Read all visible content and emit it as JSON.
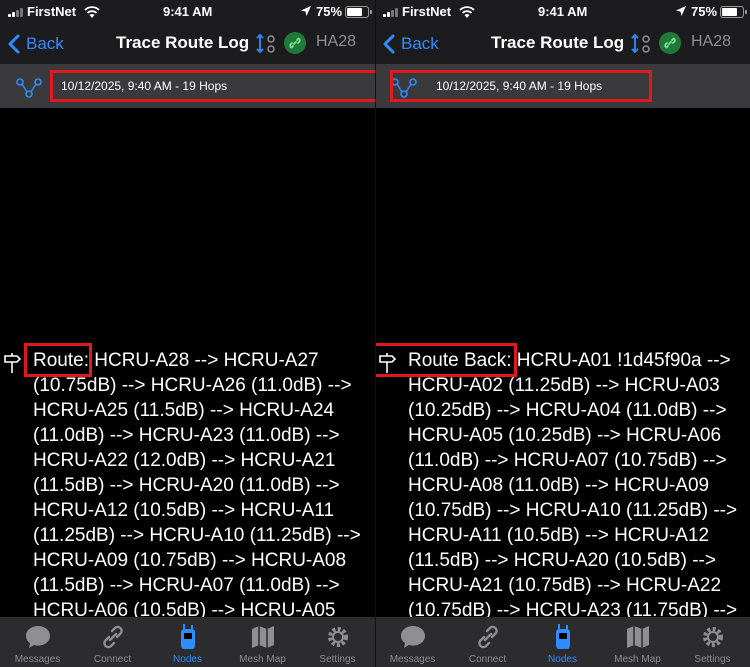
{
  "status_bar": {
    "carrier": "FirstNet",
    "time": "9:41 AM",
    "battery": "75%",
    "battery_level": 0.75
  },
  "nav": {
    "back_label": "Back",
    "title": "Trace Route Log",
    "node_short_name": "HA28"
  },
  "log_entry": {
    "label": "10/12/2025, 9:40 AM - 19 Hops"
  },
  "route_forward": {
    "label": "Route:",
    "text": " HCRU-A28 --> HCRU-A27 (10.75dB) --> HCRU-A26 (11.0dB) --> HCRU-A25 (11.5dB) --> HCRU-A24 (11.0dB) --> HCRU-A23 (11.0dB) --> HCRU-A22 (12.0dB) --> HCRU-A21 (11.5dB) --> HCRU-A20 (11.0dB) --> HCRU-A12 (10.5dB) --> HCRU-A11 (11.25dB) --> HCRU-A10 (11.25dB) --> HCRU-A09 (10.75dB) --> HCRU-A08 (11.5dB) --> HCRU-A07 (11.0dB) --> HCRU-A06 (10.5dB) --> HCRU-A05"
  },
  "route_back": {
    "label": "Route Back:",
    "text": " HCRU-A01 !1d45f90a --> HCRU-A02 (11.25dB) --> HCRU-A03 (10.25dB) --> HCRU-A04 (11.0dB) --> HCRU-A05 (10.25dB) --> HCRU-A06 (11.0dB) --> HCRU-A07 (10.75dB) --> HCRU-A08 (11.0dB) --> HCRU-A09 (10.75dB) --> HCRU-A10 (11.25dB) --> HCRU-A11 (10.5dB) --> HCRU-A12 (11.5dB) --> HCRU-A20 (10.5dB) --> HCRU-A21 (10.75dB) --> HCRU-A22 (10.75dB) --> HCRU-A23 (11.75dB) -->"
  },
  "tabs": [
    {
      "label": "Messages",
      "icon": "messages-icon"
    },
    {
      "label": "Connect",
      "icon": "link-icon"
    },
    {
      "label": "Nodes",
      "icon": "radio-device-icon"
    },
    {
      "label": "Mesh Map",
      "icon": "map-icon"
    },
    {
      "label": "Settings",
      "icon": "gear-icon"
    }
  ],
  "active_tab": "Nodes",
  "colors": {
    "accent": "#2f8cff",
    "highlight_box": "#e0191e",
    "connected_badge": "#1f7a3a",
    "header_row": "#3a3a3c",
    "bar_background": "#1c1c1e"
  }
}
